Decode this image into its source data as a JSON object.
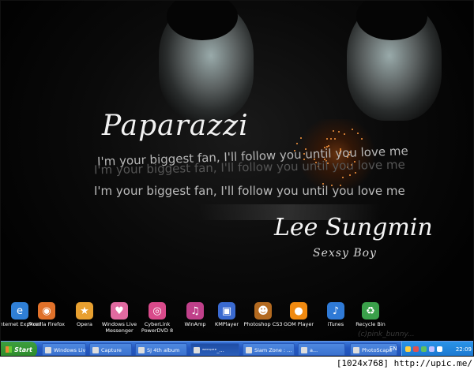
{
  "wallpaper": {
    "title": "Paparazzi",
    "quote": "I'm your biggest fan, I'll follow you until you love me",
    "artist": "Lee Sungmin",
    "subtitle": "Sexsy Boy",
    "credit": "(c)pink_bunny..."
  },
  "desktop_icons": [
    {
      "label": "Internet Explorer",
      "icon": "ie-icon",
      "color": "#2f7fd6",
      "glyph": "e"
    },
    {
      "label": "Mozilla Firefox",
      "icon": "firefox-icon",
      "color": "#e0712a",
      "glyph": "◉"
    },
    {
      "label": "Opera",
      "icon": "opera-icon",
      "color": "#e8a030",
      "glyph": "★"
    },
    {
      "label": "Windows Live Messenger",
      "icon": "messenger-icon",
      "color": "#e06aa0",
      "glyph": "♥"
    },
    {
      "label": "CyberLink PowerDVD 8",
      "icon": "powerdvd-icon",
      "color": "#d84a8a",
      "glyph": "◎"
    },
    {
      "label": "WinAmp",
      "icon": "winamp-icon",
      "color": "#c0408a",
      "glyph": "♫"
    },
    {
      "label": "KMPlayer",
      "icon": "kmplayer-icon",
      "color": "#3a6ad0",
      "glyph": "▣"
    },
    {
      "label": "Photoshop CS3",
      "icon": "photoshop-icon",
      "color": "#b36a20",
      "glyph": "☻"
    },
    {
      "label": "GOM Player",
      "icon": "gomplayer-icon",
      "color": "#f08a10",
      "glyph": "●"
    },
    {
      "label": "iTunes",
      "icon": "itunes-icon",
      "color": "#2f7ad6",
      "glyph": "♪"
    },
    {
      "label": "Recycle Bin",
      "icon": "recycle-bin-icon",
      "color": "#3aa04a",
      "glyph": "♻"
    }
  ],
  "taskbar": {
    "start_label": "Start",
    "tasks": [
      {
        "label": "Windows Liv...",
        "active": false
      },
      {
        "label": "Capture",
        "active": false
      },
      {
        "label": "SJ 4th album",
        "active": false
      },
      {
        "label": "ʷᵉᵐᵖᵉᵉ_...",
        "active": true
      },
      {
        "label": "Siam Zone : ...",
        "active": false
      },
      {
        "label": "a...",
        "active": false
      },
      {
        "label": "PhotoScape",
        "active": false
      }
    ],
    "language": "EN",
    "clock": "22:09"
  },
  "footer": {
    "text": "[1024x768] http://upic.me/"
  }
}
